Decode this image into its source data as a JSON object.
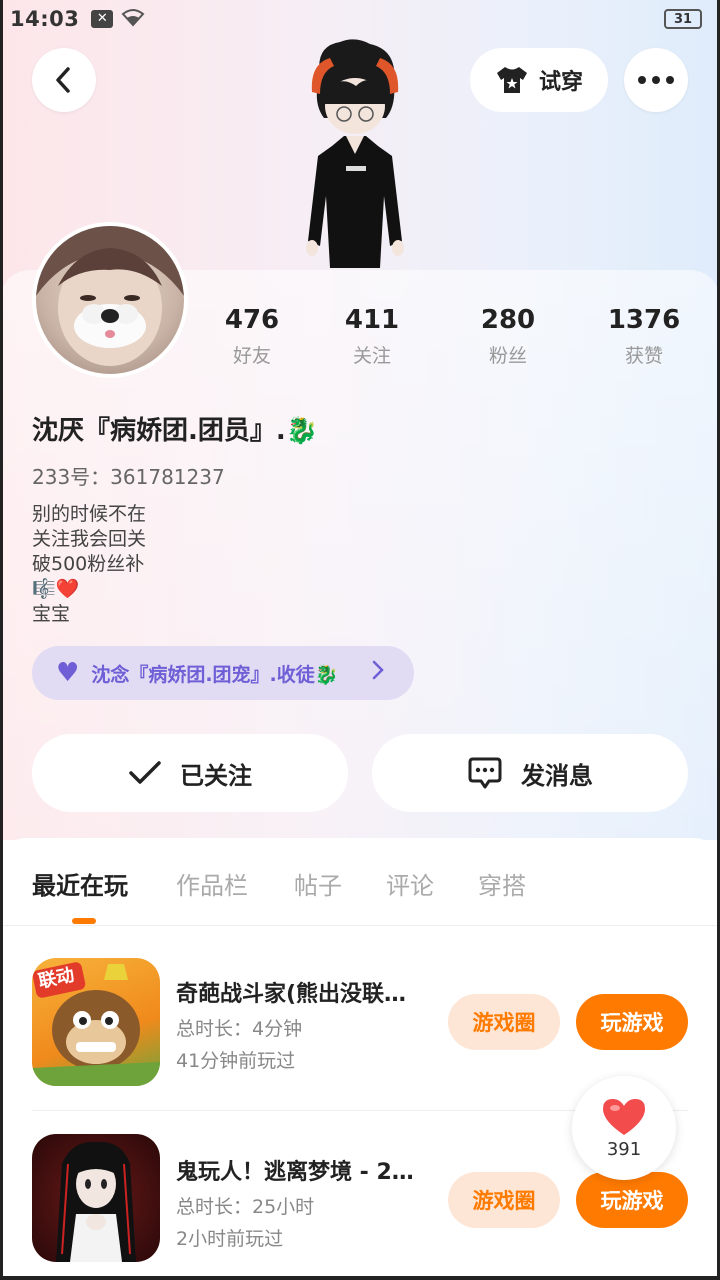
{
  "status_bar": {
    "time": "14:03",
    "battery": "31"
  },
  "header": {
    "try_on_label": "试穿"
  },
  "profile": {
    "stats": [
      {
        "value": "476",
        "label": "好友"
      },
      {
        "value": "411",
        "label": "关注"
      },
      {
        "value": "280",
        "label": "粉丝"
      },
      {
        "value": "1376",
        "label": "获赞"
      }
    ],
    "name": "沈厌『病娇团.团员』.🐉",
    "id_line": "233号：361781237",
    "bio": [
      "别的时候不在",
      "关注我会回关",
      "破500粉丝补",
      "🎼❤️",
      "宝宝"
    ],
    "group_badge": "沈念『病娇团.团宠』.收徒🐉"
  },
  "actions": {
    "follow_label": "已关注",
    "message_label": "发消息"
  },
  "tabs": [
    {
      "label": "最近在玩"
    },
    {
      "label": "作品栏"
    },
    {
      "label": "帖子"
    },
    {
      "label": "评论"
    },
    {
      "label": "穿搭"
    }
  ],
  "games": [
    {
      "title": "奇葩战斗家(熊出没联…",
      "duration": "总时长：4分钟",
      "last_played": "41分钟前玩过",
      "icon_badge": "联动",
      "circle_label": "游戏圈",
      "play_label": "玩游戏"
    },
    {
      "title": "鬼玩人！逃离梦境 - 2…",
      "duration": "总时长：25小时",
      "last_played": "2小时前玩过",
      "circle_label": "游戏圈",
      "play_label": "玩游戏"
    }
  ],
  "like_float": {
    "count": "391"
  },
  "colors": {
    "accent": "#ff7a00",
    "badge_purple": "#6f5fd6"
  }
}
